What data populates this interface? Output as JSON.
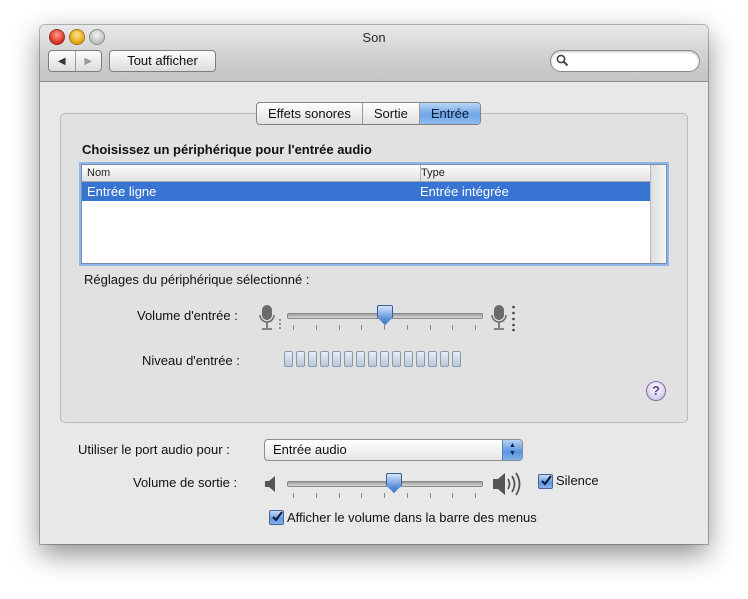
{
  "window": {
    "title": "Son"
  },
  "toolbar": {
    "back": "◀",
    "forward": "▶",
    "show_all": "Tout afficher",
    "search_placeholder": ""
  },
  "tabs": [
    {
      "label": "Effets sonores",
      "active": false
    },
    {
      "label": "Sortie",
      "active": false
    },
    {
      "label": "Entrée",
      "active": true
    }
  ],
  "input": {
    "heading": "Choisissez un périphérique pour l'entrée audio",
    "table": {
      "columns": [
        "Nom",
        "Type"
      ],
      "rows": [
        {
          "name": "Entrée ligne",
          "type": "Entrée intégrée",
          "selected": true
        }
      ]
    },
    "settings_label": "Réglages du périphérique sélectionné :",
    "volume_label": "Volume d'entrée :",
    "volume_value": 0.5,
    "level_label": "Niveau d'entrée :",
    "level_segments": 15,
    "level_active": 0
  },
  "help": {
    "label": "?"
  },
  "output": {
    "port_label": "Utiliser le port audio pour :",
    "port_value": "Entrée audio",
    "volume_label": "Volume de sortie :",
    "volume_value": 0.55,
    "mute_label": "Silence",
    "mute_checked": true,
    "menubar_label": "Afficher le volume dans la barre des menus",
    "menubar_checked": true
  },
  "colors": {
    "selection": "#3874d4",
    "accent": "#5e92d9"
  },
  "icons": {
    "mic_low": "microphone-icon",
    "mic_high": "microphone-icon",
    "speaker_low": "speaker-low-icon",
    "speaker_high": "speaker-high-icon",
    "search": "magnifier-icon"
  }
}
